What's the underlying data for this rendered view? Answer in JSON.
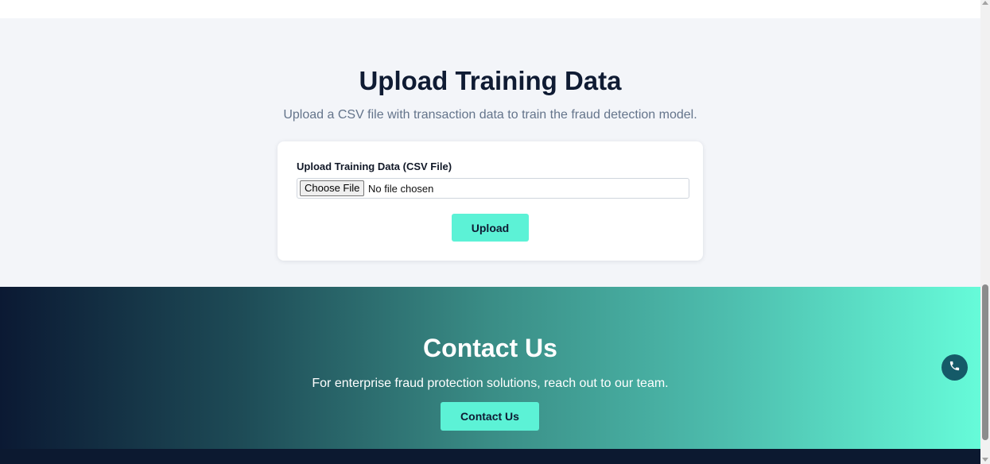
{
  "upload": {
    "title": "Upload Training Data",
    "subtitle": "Upload a CSV file with transaction data to train the fraud detection model.",
    "field_label": "Upload Training Data (CSV File)",
    "choose_file_label": "Choose File",
    "file_status": "No file chosen",
    "upload_button": "Upload"
  },
  "contact": {
    "title": "Contact Us",
    "text": "For enterprise fraud protection solutions, reach out to our team.",
    "button": "Contact Us"
  },
  "icons": {
    "floating_action": "phone-icon"
  },
  "colors": {
    "accent": "#5cf2d6",
    "heading": "#0f1b33",
    "gradient_start": "#0b1933",
    "gradient_end": "#66fbd9",
    "fab": "#155a68"
  }
}
